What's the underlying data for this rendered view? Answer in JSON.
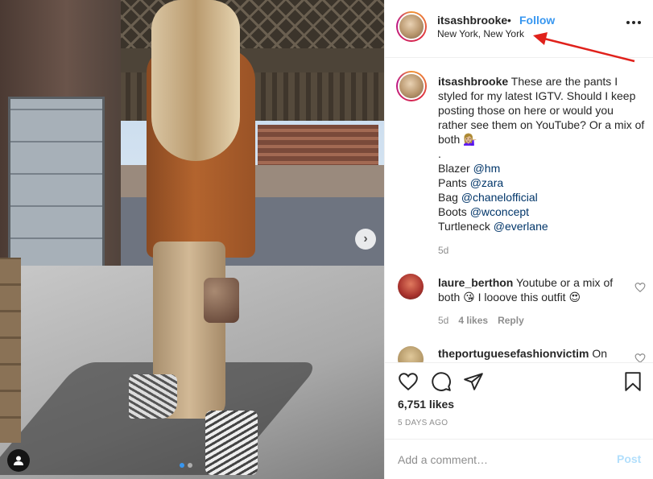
{
  "post": {
    "photo_alt": "",
    "carousel": {
      "count": 2,
      "active_index": 0
    },
    "next_icon": "chevron-right-icon",
    "user_tag_icon": "user-icon"
  },
  "header": {
    "username": "itsashbrooke",
    "separator": "•",
    "follow_label": "Follow",
    "location": "New York, New York",
    "more_icon": "more-horizontal-icon"
  },
  "caption": {
    "username": "itsashbrooke",
    "text": "These are the pants I styled for my latest IGTV. Should I keep posting those on here or would you rather see them on YouTube? Or a mix of both 💁🏼‍♀️",
    "dot": ".",
    "credits": [
      {
        "label": "Blazer",
        "mention": "@hm"
      },
      {
        "label": "Pants",
        "mention": "@zara"
      },
      {
        "label": "Bag",
        "mention": "@chanelofficial"
      },
      {
        "label": "Boots",
        "mention": "@wconcept"
      },
      {
        "label": "Turtleneck",
        "mention": "@everlane"
      }
    ],
    "time": "5d"
  },
  "comments": [
    {
      "username": "laure_berthon",
      "text": "Youtube or a mix of both 😘 I looove this outfit 😍",
      "time": "5d",
      "likes": "4 likes",
      "reply_label": "Reply"
    },
    {
      "username": "theportuguesefashionvictim",
      "text": "On"
    }
  ],
  "actions": {
    "like_icon": "heart-icon",
    "comment_icon": "comment-icon",
    "share_icon": "paper-plane-icon",
    "save_icon": "bookmark-icon",
    "likes": "6,751 likes",
    "date": "5 DAYS AGO"
  },
  "add_comment": {
    "placeholder": "Add a comment…",
    "post_label": "Post"
  },
  "colors": {
    "accent": "#3897f0",
    "mention": "#003569",
    "muted": "#8e8e8e",
    "annotation_arrow": "#e0211b"
  }
}
